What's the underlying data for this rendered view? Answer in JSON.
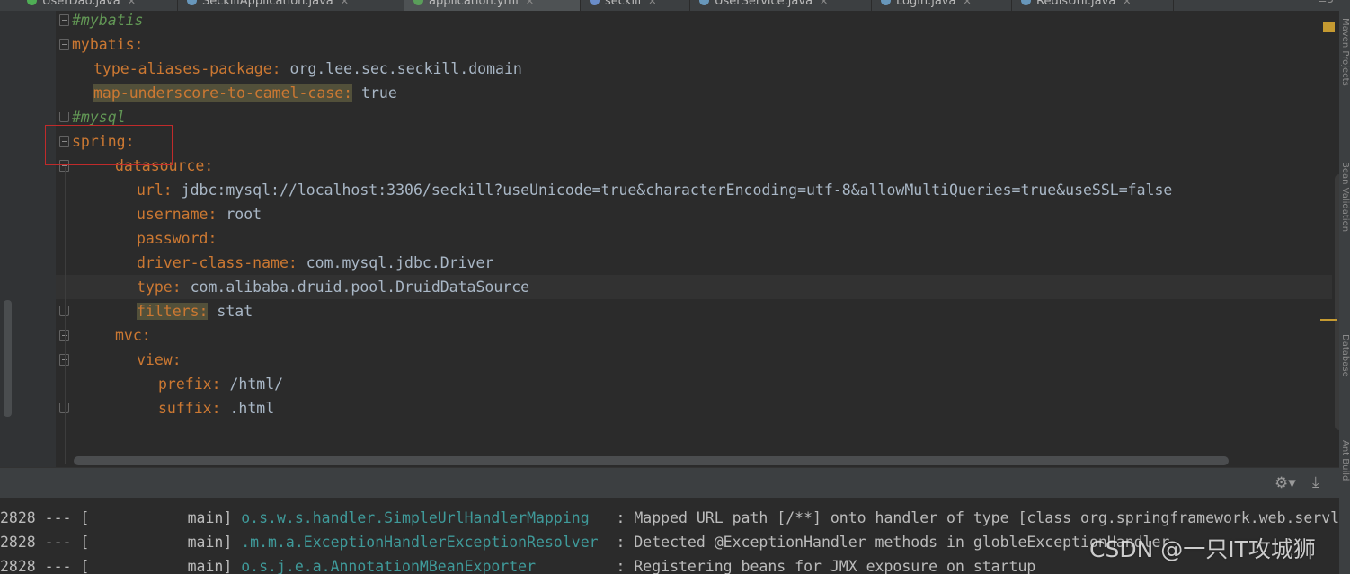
{
  "tabs": [
    {
      "label": "UserDao.java",
      "dot": "#4fae55"
    },
    {
      "label": "SeckillApplication.java",
      "dot": "#6897bb"
    },
    {
      "label": "application.yml",
      "dot": "#5a9e5a"
    },
    {
      "label": "seckill",
      "dot": "#6a8dc9"
    },
    {
      "label": "UserService.java",
      "dot": "#6897bb"
    },
    {
      "label": "Login.java",
      "dot": "#6897bb"
    },
    {
      "label": "RedisUtil.java",
      "dot": "#6897bb"
    }
  ],
  "tabbar_right": "≡5",
  "editor": {
    "lines": [
      {
        "indent": "",
        "comment": "#mybatis"
      },
      {
        "indent": "",
        "key": "mybatis:"
      },
      {
        "indent": "  ",
        "key": "type-aliases-package:",
        "value": " org.lee.sec.seckill.domain"
      },
      {
        "indent": "  ",
        "key": "map-underscore-to-camel-case:",
        "value": " true"
      },
      {
        "indent": "",
        "comment": "#mysql"
      },
      {
        "indent": "",
        "key": "spring:"
      },
      {
        "indent": "    ",
        "key": "datasource:"
      },
      {
        "indent": "      ",
        "key": "url:",
        "value": " jdbc:mysql://localhost:3306/seckill?useUnicode=true&characterEncoding=utf-8&allowMultiQueries=true&useSSL=false"
      },
      {
        "indent": "      ",
        "key": "username:",
        "value": " root"
      },
      {
        "indent": "      ",
        "key": "password:",
        "value": ""
      },
      {
        "indent": "      ",
        "key": "driver-class-name:",
        "value": " com.mysql.jdbc.Driver"
      },
      {
        "indent": "      ",
        "key": "type:",
        "value": " com.alibaba.druid.pool.DruidDataSource"
      },
      {
        "indent": "      ",
        "key": "filters:",
        "value": " stat"
      },
      {
        "indent": "    ",
        "key": "mvc:"
      },
      {
        "indent": "      ",
        "key": "view:"
      },
      {
        "indent": "        ",
        "key": "prefix:",
        "value": " /html/"
      },
      {
        "indent": "        ",
        "key": "suffix:",
        "value": " .html"
      }
    ]
  },
  "side_panels": [
    "Maven Projects",
    "Bean Validation",
    "Database",
    "Ant Build"
  ],
  "console": {
    "logs": [
      {
        "pid": "2828 --- [",
        "thread": "           main]",
        "cls": " o.s.w.s.handler.SimpleUrlHandlerMapping  ",
        "msg": " : Mapped URL path [/**] onto handler of type [class org.springframework.web.servlet.resource.ResourceHttpRequestHandler]"
      },
      {
        "pid": "2828 --- [",
        "thread": "           main]",
        "cls": " .m.m.a.ExceptionHandlerExceptionResolver ",
        "msg": " : Detected @ExceptionHandler methods in globleExceptionHandler"
      },
      {
        "pid": "2828 --- [",
        "thread": "           main]",
        "cls": " o.s.j.e.a.AnnotationMBeanExporter        ",
        "msg": " : Registering beans for JMX exposure on startup"
      }
    ]
  },
  "watermark": "CSDN @一只IT攻城狮"
}
